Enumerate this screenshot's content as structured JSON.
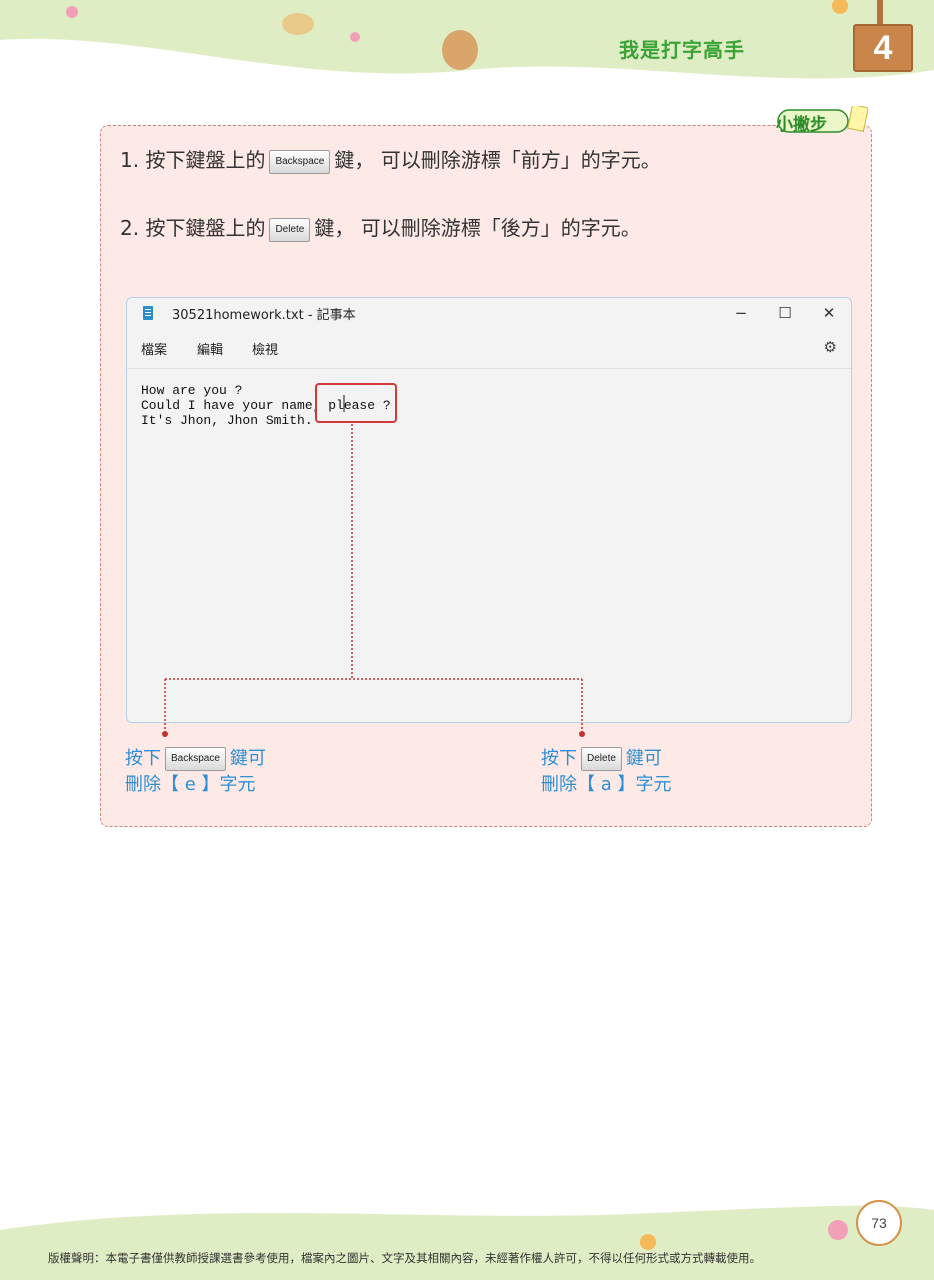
{
  "header": {
    "chapter_title": "我是打字高手",
    "chapter_number": "4"
  },
  "tip": {
    "badge": "小撇步",
    "step1": {
      "num": "1.",
      "before": "按下鍵盤上的",
      "key": "Backspace",
      "after": "鍵， 可以刪除游標「前方」的字元。"
    },
    "step2": {
      "num": "2.",
      "before": "按下鍵盤上的",
      "key": "Delete",
      "after": "鍵， 可以刪除游標「後方」的字元。"
    }
  },
  "notepad": {
    "title": "30521homework.txt - 記事本",
    "controls": {
      "minimize": "−",
      "maximize": "☐",
      "close": "✕"
    },
    "menu": [
      "檔案",
      "編輯",
      "檢視"
    ],
    "settings_icon": "gear-icon",
    "content": "How are you ?\nCould I have your name, please ?\nIt's Jhon, Jhon Smith."
  },
  "captions": {
    "left": {
      "before": "按下",
      "key": "Backspace",
      "after": "鍵可",
      "line2": "刪除【 e 】字元"
    },
    "right": {
      "before": "按下",
      "key": "Delete",
      "after": "鍵可",
      "line2": "刪除【 a 】字元"
    }
  },
  "footer": {
    "page_number": "73",
    "copyright": "版權聲明：本電子書僅供教師授課選書參考使用，檔案內之圖片、文字及其相關內容，未經著作權人許可，不得以任何形式或方式轉載使用。"
  },
  "colors": {
    "panel_bg": "#fde9e6",
    "panel_border": "#d0837b",
    "title_green": "#3aa336",
    "caption_blue": "#2f8fd6",
    "highlight_red": "#d23a3a"
  }
}
